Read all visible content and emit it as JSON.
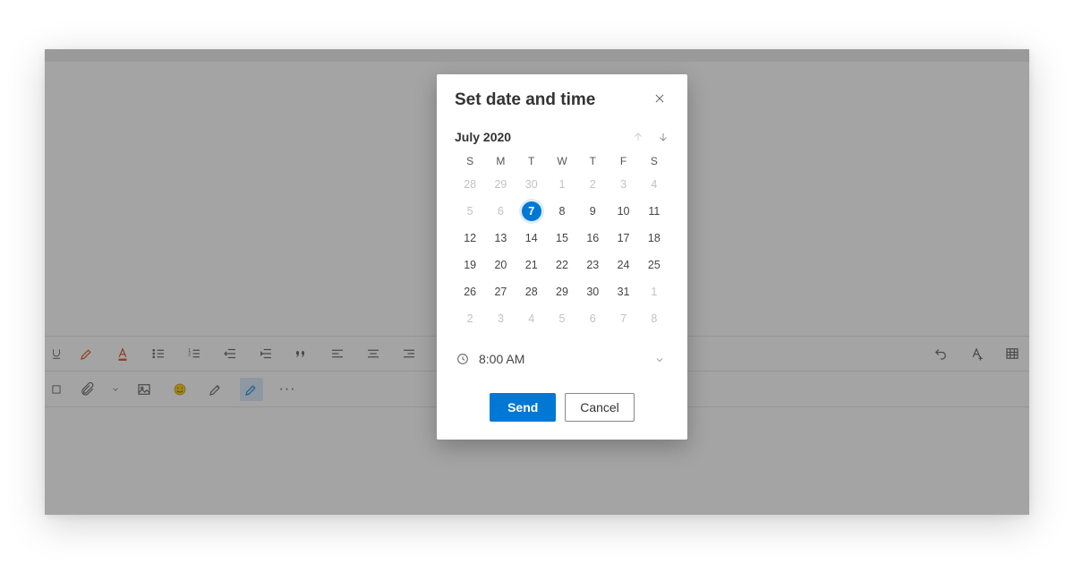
{
  "modal": {
    "title": "Set date and time",
    "month_label": "July 2020",
    "dow": [
      "S",
      "M",
      "T",
      "W",
      "T",
      "F",
      "S"
    ],
    "weeks": [
      [
        {
          "n": 28,
          "out": true
        },
        {
          "n": 29,
          "out": true
        },
        {
          "n": 30,
          "out": true
        },
        {
          "n": 1,
          "out": true
        },
        {
          "n": 2,
          "out": true
        },
        {
          "n": 3,
          "out": true
        },
        {
          "n": 4,
          "out": true
        }
      ],
      [
        {
          "n": 5,
          "out": true
        },
        {
          "n": 6,
          "out": true
        },
        {
          "n": 7,
          "sel": true
        },
        {
          "n": 8
        },
        {
          "n": 9
        },
        {
          "n": 10
        },
        {
          "n": 11
        }
      ],
      [
        {
          "n": 12
        },
        {
          "n": 13
        },
        {
          "n": 14
        },
        {
          "n": 15
        },
        {
          "n": 16
        },
        {
          "n": 17
        },
        {
          "n": 18
        }
      ],
      [
        {
          "n": 19
        },
        {
          "n": 20
        },
        {
          "n": 21
        },
        {
          "n": 22
        },
        {
          "n": 23
        },
        {
          "n": 24
        },
        {
          "n": 25
        }
      ],
      [
        {
          "n": 26
        },
        {
          "n": 27
        },
        {
          "n": 28
        },
        {
          "n": 29
        },
        {
          "n": 30
        },
        {
          "n": 31
        },
        {
          "n": 1,
          "out": true
        }
      ],
      [
        {
          "n": 2,
          "out": true
        },
        {
          "n": 3,
          "out": true
        },
        {
          "n": 4,
          "out": true
        },
        {
          "n": 5,
          "out": true
        },
        {
          "n": 6,
          "out": true
        },
        {
          "n": 7,
          "out": true
        },
        {
          "n": 8,
          "out": true
        }
      ]
    ],
    "time_value": "8:00 AM",
    "send_label": "Send",
    "cancel_label": "Cancel"
  },
  "toolbar": {
    "row1_icons": [
      "underline",
      "highlighter",
      "font-color",
      "bullets",
      "numbered-list",
      "outdent",
      "indent",
      "quote",
      "align",
      "align-center",
      "align-right",
      "link",
      "spacer",
      "spacer",
      "spacer",
      "spacer",
      "spacer",
      "spacer",
      "spacer",
      "spacer",
      "spacer",
      "spacer",
      "undo",
      "clear-format",
      "table"
    ],
    "row2_icons": [
      "box",
      "attach",
      "chevron",
      "image",
      "emoji",
      "signature",
      "format-painter",
      "more"
    ]
  }
}
